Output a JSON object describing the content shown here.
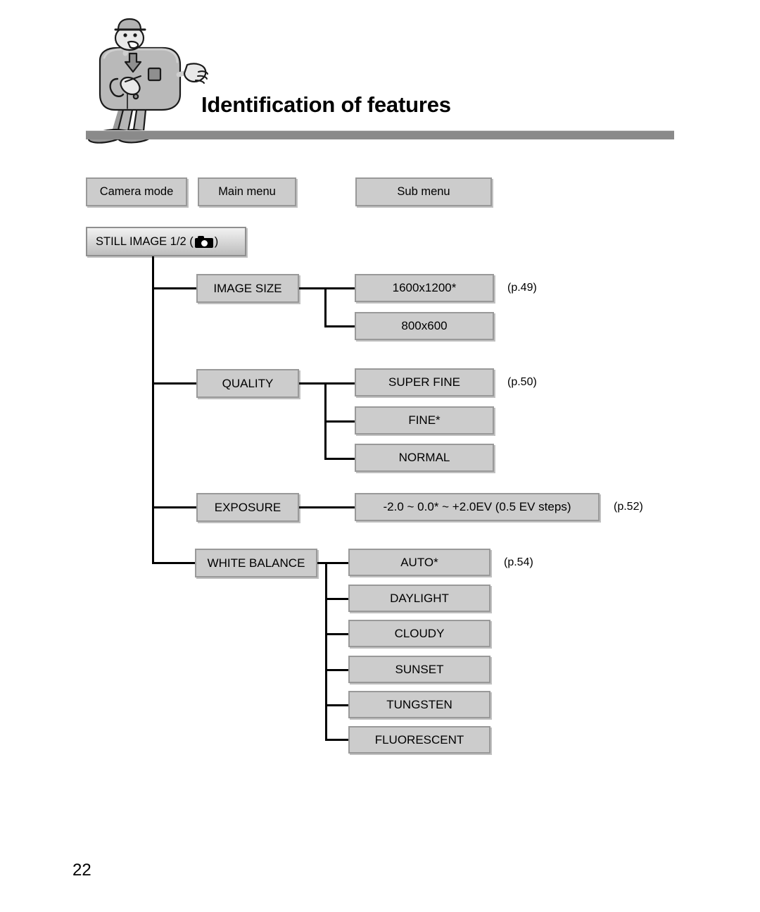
{
  "document": {
    "title": "Identification of features",
    "page_number": "22",
    "mascot_icon": "camera-mascot-character"
  },
  "columns": [
    {
      "label": "Camera mode",
      "name": "camera-mode"
    },
    {
      "label": "Main menu",
      "name": "main-menu"
    },
    {
      "label": "Sub menu",
      "name": "sub-menu"
    }
  ],
  "mode": {
    "label_before": "STILL IMAGE 1/2 (",
    "label_after": ")",
    "icon": "still-camera-icon"
  },
  "menu_tree": [
    {
      "name": "image-size",
      "label": "IMAGE SIZE",
      "page_ref": "(p.49)",
      "options": [
        {
          "label": "1600x1200*"
        },
        {
          "label": "800x600"
        }
      ]
    },
    {
      "name": "quality",
      "label": "QUALITY",
      "page_ref": "(p.50)",
      "options": [
        {
          "label": "SUPER FINE"
        },
        {
          "label": "FINE*"
        },
        {
          "label": "NORMAL"
        }
      ]
    },
    {
      "name": "exposure",
      "label": "EXPOSURE",
      "page_ref": "(p.52)",
      "options": [
        {
          "label": "-2.0 ~ 0.0* ~ +2.0EV (0.5 EV steps)"
        }
      ]
    },
    {
      "name": "white-balance",
      "label": "WHITE BALANCE",
      "page_ref": "(p.54)",
      "options": [
        {
          "label": "AUTO*"
        },
        {
          "label": "DAYLIGHT"
        },
        {
          "label": "CLOUDY"
        },
        {
          "label": "SUNSET"
        },
        {
          "label": "TUNGSTEN"
        },
        {
          "label": "FLUORESCENT"
        }
      ]
    }
  ],
  "colors": {
    "box_fill": "#cccccc",
    "box_border": "#999999",
    "rule_bar": "#8a8a8a",
    "line": "#000000"
  }
}
